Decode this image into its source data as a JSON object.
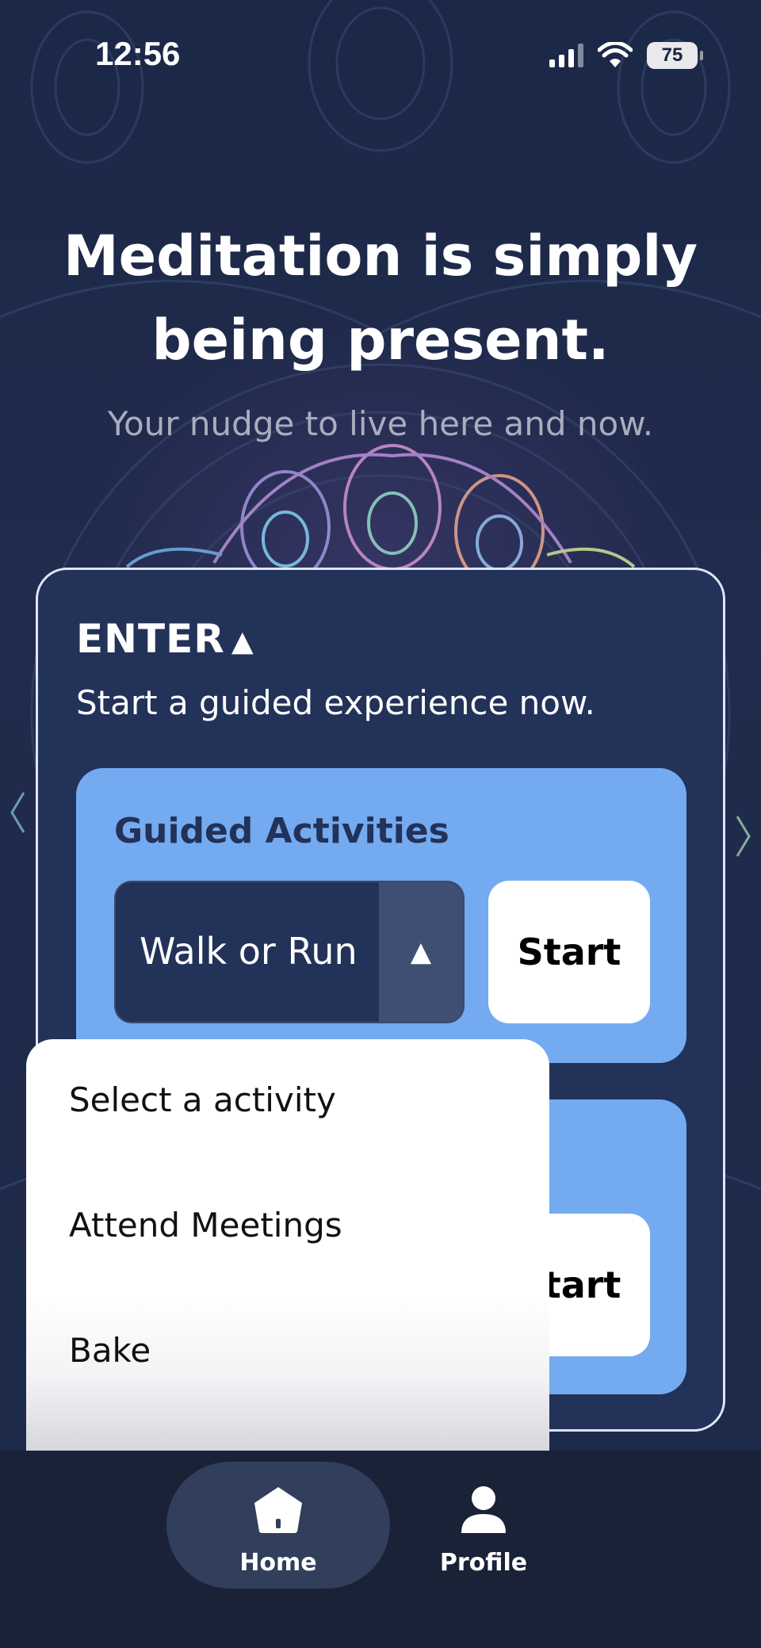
{
  "status_bar": {
    "time": "12:56",
    "battery": "75"
  },
  "hero": {
    "headline": "Meditation is simply being present.",
    "subline": "Your nudge to live here and now."
  },
  "enter_card": {
    "title": "ENTER",
    "caret": "▲",
    "subtitle": "Start a guided experience now."
  },
  "guided_activities": {
    "title": "Guided Activities",
    "selected_value": "Walk or Run",
    "toggle_icon": "▲",
    "start_label": "Start"
  },
  "second_panel": {
    "start_label": "Start"
  },
  "dropdown": {
    "options": [
      "Select a activity",
      "Attend Meetings",
      "Bake"
    ]
  },
  "bottom_nav": {
    "items": [
      {
        "label": "Home",
        "icon": "home-icon",
        "active": true
      },
      {
        "label": "Profile",
        "icon": "profile-icon",
        "active": false
      }
    ]
  },
  "colors": {
    "background": "#1c2848",
    "card": "#223259",
    "panel": "#74aaf0",
    "navbar": "#1a2238",
    "nav_active": "#313e5c"
  }
}
